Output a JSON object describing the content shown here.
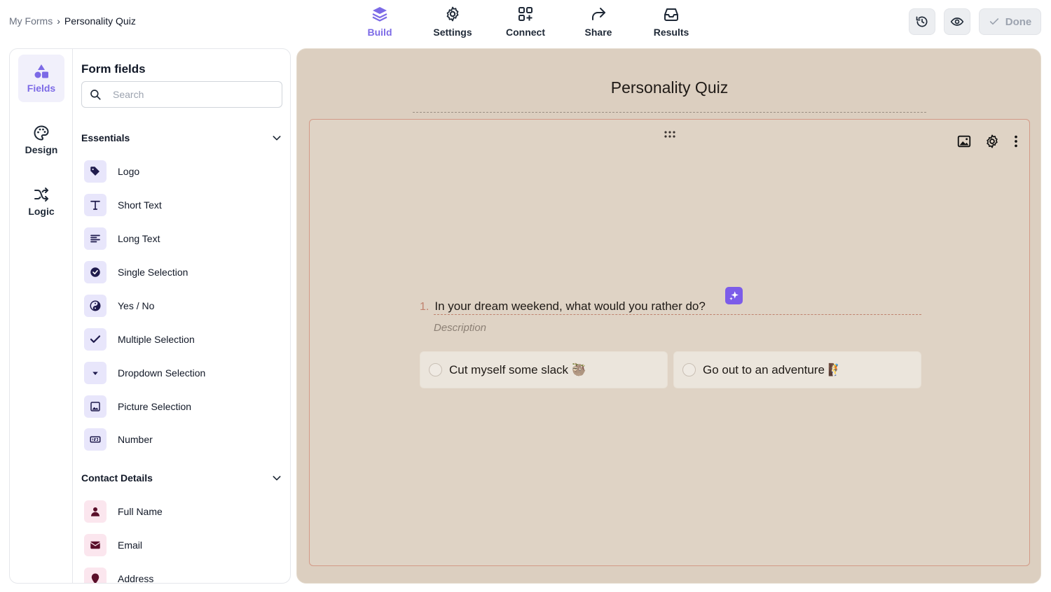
{
  "breadcrumb": {
    "root": "My Forms",
    "separator": "›",
    "current": "Personality Quiz"
  },
  "nav_tabs": [
    {
      "label": "Build",
      "icon": "layers-icon",
      "active": true
    },
    {
      "label": "Settings",
      "icon": "gear-icon",
      "active": false
    },
    {
      "label": "Connect",
      "icon": "apps-plus-icon",
      "active": false
    },
    {
      "label": "Share",
      "icon": "share-arrow-icon",
      "active": false
    },
    {
      "label": "Results",
      "icon": "inbox-icon",
      "active": false
    }
  ],
  "top_actions": {
    "history_icon": "history-icon",
    "preview_icon": "eye-icon",
    "done_label": "Done"
  },
  "rail": [
    {
      "label": "Fields",
      "icon": "shapes-icon",
      "active": true
    },
    {
      "label": "Design",
      "icon": "palette-icon",
      "active": false
    },
    {
      "label": "Logic",
      "icon": "shuffle-icon",
      "active": false
    }
  ],
  "fields_panel": {
    "title": "Form fields",
    "search_placeholder": "Search",
    "essentials": {
      "heading": "Essentials",
      "items": [
        "Logo",
        "Short Text",
        "Long Text",
        "Single Selection",
        "Yes / No",
        "Multiple Selection",
        "Dropdown Selection",
        "Picture Selection",
        "Number"
      ]
    },
    "contact": {
      "heading": "Contact Details",
      "items": [
        "Full Name",
        "Email",
        "Address"
      ]
    }
  },
  "form": {
    "title": "Personality Quiz",
    "question_number": "1.",
    "question": "In your dream weekend, what would you rather do?",
    "description_placeholder": "Description",
    "options": [
      "Cut myself some slack 🦥",
      "Go out to an adventure 🧗"
    ]
  },
  "colors": {
    "accent": "#7c6ae6",
    "canvas_bg": "#dccfc0",
    "card_border": "#d39a87"
  }
}
